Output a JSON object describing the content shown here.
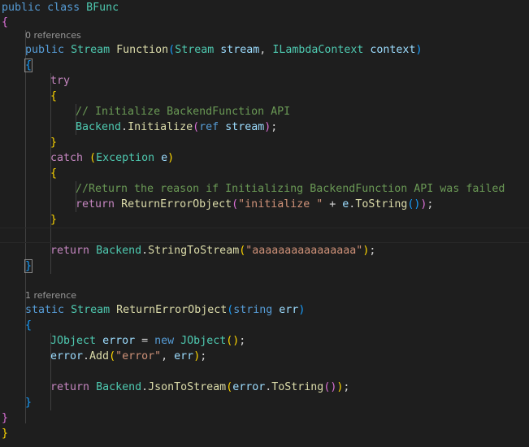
{
  "colors": {
    "background": "#1e1e1e",
    "keyword": "#569cd6",
    "control": "#c586c0",
    "type": "#4ec9b0",
    "function": "#dcdcaa",
    "variable": "#9cdcfe",
    "string": "#ce9178",
    "comment": "#6a9955",
    "punct": "#d4d4d4",
    "brace1": "#ffd700",
    "brace2": "#da70d6",
    "brace3": "#179fff",
    "codelens": "#999999"
  },
  "codelens": [
    {
      "text": "0 references"
    },
    {
      "text": "1 reference"
    }
  ],
  "lines": [
    {
      "indent": 0,
      "tokens": [
        {
          "t": "public",
          "c": "keyword"
        },
        {
          "t": " "
        },
        {
          "t": "class",
          "c": "keyword"
        },
        {
          "t": " "
        },
        {
          "t": "BFunc",
          "c": "type"
        }
      ]
    },
    {
      "indent": 0,
      "tokens": [
        {
          "t": "{",
          "c": "brace2"
        }
      ]
    },
    {
      "codelens": 0,
      "indent": 1
    },
    {
      "indent": 1,
      "tokens": [
        {
          "t": "public",
          "c": "keyword"
        },
        {
          "t": " "
        },
        {
          "t": "Stream",
          "c": "type"
        },
        {
          "t": " "
        },
        {
          "t": "Function",
          "c": "function"
        },
        {
          "t": "(",
          "c": "brace3"
        },
        {
          "t": "Stream",
          "c": "type"
        },
        {
          "t": " "
        },
        {
          "t": "stream",
          "c": "variable"
        },
        {
          "t": ", "
        },
        {
          "t": "ILambdaContext",
          "c": "type"
        },
        {
          "t": " "
        },
        {
          "t": "context",
          "c": "variable"
        },
        {
          "t": ")",
          "c": "brace3"
        }
      ]
    },
    {
      "indent": 1,
      "tokens": [
        {
          "t": "{",
          "c": "brace3",
          "match": true
        }
      ]
    },
    {
      "indent": 2,
      "tokens": [
        {
          "t": "try",
          "c": "control"
        }
      ]
    },
    {
      "indent": 2,
      "tokens": [
        {
          "t": "{",
          "c": "brace1"
        }
      ]
    },
    {
      "indent": 3,
      "tokens": [
        {
          "t": "// Initialize BackendFunction API",
          "c": "comment"
        }
      ]
    },
    {
      "indent": 3,
      "tokens": [
        {
          "t": "Backend",
          "c": "type"
        },
        {
          "t": "."
        },
        {
          "t": "Initialize",
          "c": "function"
        },
        {
          "t": "(",
          "c": "brace2"
        },
        {
          "t": "ref",
          "c": "keyword"
        },
        {
          "t": " "
        },
        {
          "t": "stream",
          "c": "variable"
        },
        {
          "t": ")",
          "c": "brace2"
        },
        {
          "t": ";"
        }
      ]
    },
    {
      "indent": 2,
      "tokens": [
        {
          "t": "}",
          "c": "brace1"
        }
      ]
    },
    {
      "indent": 2,
      "tokens": [
        {
          "t": "catch",
          "c": "control"
        },
        {
          "t": " "
        },
        {
          "t": "(",
          "c": "brace1"
        },
        {
          "t": "Exception",
          "c": "type"
        },
        {
          "t": " "
        },
        {
          "t": "e",
          "c": "variable"
        },
        {
          "t": ")",
          "c": "brace1"
        }
      ]
    },
    {
      "indent": 2,
      "tokens": [
        {
          "t": "{",
          "c": "brace1"
        }
      ]
    },
    {
      "indent": 3,
      "tokens": [
        {
          "t": "//Return the reason if Initializing BackendFunction API was failed",
          "c": "comment"
        }
      ]
    },
    {
      "indent": 3,
      "tokens": [
        {
          "t": "return",
          "c": "control"
        },
        {
          "t": " "
        },
        {
          "t": "ReturnErrorObject",
          "c": "function"
        },
        {
          "t": "(",
          "c": "brace2"
        },
        {
          "t": "\"initialize \"",
          "c": "string"
        },
        {
          "t": " + "
        },
        {
          "t": "e",
          "c": "variable"
        },
        {
          "t": "."
        },
        {
          "t": "ToString",
          "c": "function"
        },
        {
          "t": "()",
          "c": "brace3"
        },
        {
          "t": ")",
          "c": "brace2"
        },
        {
          "t": ";"
        }
      ]
    },
    {
      "indent": 2,
      "tokens": [
        {
          "t": "}",
          "c": "brace1"
        }
      ]
    },
    {
      "indent": 2,
      "current": true,
      "tokens": []
    },
    {
      "indent": 2,
      "tokens": [
        {
          "t": "return",
          "c": "control"
        },
        {
          "t": " "
        },
        {
          "t": "Backend",
          "c": "type"
        },
        {
          "t": "."
        },
        {
          "t": "StringToStream",
          "c": "function"
        },
        {
          "t": "(",
          "c": "brace1"
        },
        {
          "t": "\"aaaaaaaaaaaaaaaa\"",
          "c": "string"
        },
        {
          "t": ")",
          "c": "brace1"
        },
        {
          "t": ";"
        }
      ]
    },
    {
      "indent": 1,
      "tokens": [
        {
          "t": "}",
          "c": "brace3",
          "match": true
        }
      ]
    },
    {
      "indent": 1,
      "tokens": []
    },
    {
      "codelens": 1,
      "indent": 1
    },
    {
      "indent": 1,
      "tokens": [
        {
          "t": "static",
          "c": "keyword"
        },
        {
          "t": " "
        },
        {
          "t": "Stream",
          "c": "type"
        },
        {
          "t": " "
        },
        {
          "t": "ReturnErrorObject",
          "c": "function"
        },
        {
          "t": "(",
          "c": "brace3"
        },
        {
          "t": "string",
          "c": "keyword"
        },
        {
          "t": " "
        },
        {
          "t": "err",
          "c": "variable"
        },
        {
          "t": ")",
          "c": "brace3"
        }
      ]
    },
    {
      "indent": 1,
      "tokens": [
        {
          "t": "{",
          "c": "brace3"
        }
      ]
    },
    {
      "indent": 2,
      "tokens": [
        {
          "t": "JObject",
          "c": "type"
        },
        {
          "t": " "
        },
        {
          "t": "error",
          "c": "variable"
        },
        {
          "t": " = "
        },
        {
          "t": "new",
          "c": "keyword"
        },
        {
          "t": " "
        },
        {
          "t": "JObject",
          "c": "type"
        },
        {
          "t": "()",
          "c": "brace1"
        },
        {
          "t": ";"
        }
      ]
    },
    {
      "indent": 2,
      "tokens": [
        {
          "t": "error",
          "c": "variable"
        },
        {
          "t": "."
        },
        {
          "t": "Add",
          "c": "function"
        },
        {
          "t": "(",
          "c": "brace1"
        },
        {
          "t": "\"error\"",
          "c": "string"
        },
        {
          "t": ", "
        },
        {
          "t": "err",
          "c": "variable"
        },
        {
          "t": ")",
          "c": "brace1"
        },
        {
          "t": ";"
        }
      ]
    },
    {
      "indent": 2,
      "tokens": []
    },
    {
      "indent": 2,
      "tokens": [
        {
          "t": "return",
          "c": "control"
        },
        {
          "t": " "
        },
        {
          "t": "Backend",
          "c": "type"
        },
        {
          "t": "."
        },
        {
          "t": "JsonToStream",
          "c": "function"
        },
        {
          "t": "(",
          "c": "brace1"
        },
        {
          "t": "error",
          "c": "variable"
        },
        {
          "t": "."
        },
        {
          "t": "ToString",
          "c": "function"
        },
        {
          "t": "()",
          "c": "brace2"
        },
        {
          "t": ")",
          "c": "brace1"
        },
        {
          "t": ";"
        }
      ]
    },
    {
      "indent": 1,
      "tokens": [
        {
          "t": "}",
          "c": "brace3"
        }
      ]
    },
    {
      "indent": 0,
      "tokens": [
        {
          "t": "}",
          "c": "brace2"
        }
      ]
    },
    {
      "indent": 0,
      "tokens": [
        {
          "t": "}",
          "c": "brace1"
        }
      ]
    }
  ]
}
